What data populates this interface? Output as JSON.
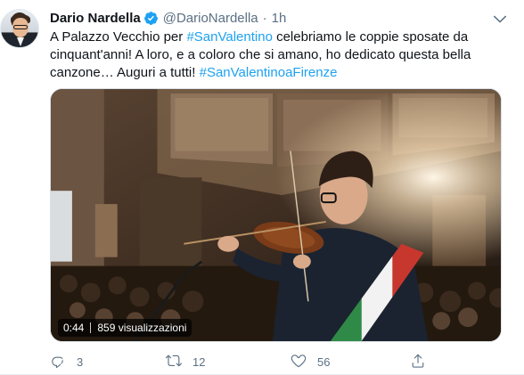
{
  "tweet": {
    "author_name": "Dario Nardella",
    "handle": "@DarioNardella",
    "separator": "·",
    "time": "1h",
    "text_parts": [
      "A Palazzo Vecchio per ",
      "#SanValentino",
      " celebriamo le coppie sposate da cinquant'anni! A loro, e a coloro che si amano, ho dedicato questa bella canzone… Auguri a tutti! ",
      "#SanValentinoaFirenze"
    ]
  },
  "video": {
    "duration": "0:44",
    "views": "859 visualizzazioni"
  },
  "actions": {
    "reply_count": "3",
    "retweet_count": "12",
    "like_count": "56"
  },
  "colors": {
    "accent": "#1da1f2",
    "secondary_text": "#5b7083",
    "verified": "#1da1f2"
  },
  "icons": {
    "verified": "verified-badge-icon",
    "caret": "chevron-down-icon",
    "reply": "reply-icon",
    "retweet": "retweet-icon",
    "like": "heart-icon",
    "share": "share-icon"
  }
}
